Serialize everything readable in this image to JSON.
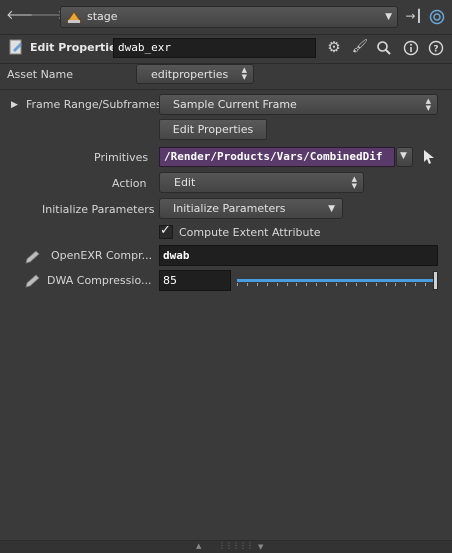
{
  "pathbar": {
    "back_icon": "arrow-left-icon",
    "forward_icon": "arrow-right-icon",
    "network_icon": "stage-network-icon",
    "network_name": "stage",
    "pin_icon": "pin-icon",
    "link_icon": "link-icon"
  },
  "node_header": {
    "node_type": "Edit Properties",
    "node_name": "dwab_exr",
    "gear_icon": "gear-icon",
    "brush_icon": "brush-icon",
    "search_icon": "search-icon",
    "info_icon": "info-icon",
    "help_icon": "help-icon"
  },
  "asset": {
    "label": "Asset Name",
    "value": "editproperties"
  },
  "params": {
    "frame_range_label": "Frame Range/Subframes",
    "frame_range_value": "Sample Current Frame",
    "edit_properties_button": "Edit Properties",
    "primitives_label": "Primitives",
    "primitives_value": "/Render/Products/Vars/CombinedDif",
    "action_label": "Action",
    "action_value": "Edit",
    "init_params_label": "Initialize Parameters",
    "init_params_value": "Initialize Parameters",
    "compute_extent_label": "Compute Extent Attribute",
    "compute_extent_checked": true,
    "openexr_label": "OpenEXR Compr...",
    "openexr_value": "dwab",
    "dwa_label": "DWA Compressio...",
    "dwa_value": "85",
    "dwa_slider_fraction": 1.0
  }
}
